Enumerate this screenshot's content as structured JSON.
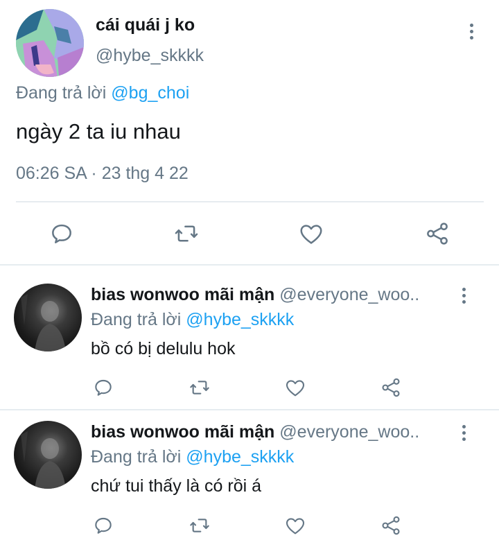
{
  "tweet": {
    "author_name": "cái quái j ko",
    "author_handle": "@hybe_skkkk",
    "replying_prefix": "Đang trả lời",
    "replying_to": "@bg_choi",
    "text": "ngày 2 ta iu nhau",
    "timestamp": "06:26 SA · 23 thg 4 22",
    "actions": [
      "reply-icon",
      "retweet-icon",
      "like-icon",
      "share-icon"
    ]
  },
  "replies": [
    {
      "author_name": "bias wonwoo mãi mận",
      "author_handle": "@everyone_woo..",
      "replying_prefix": "Đang trả lời",
      "replying_to": "@hybe_skkkk",
      "text": "bồ có bị delulu hok"
    },
    {
      "author_name": "bias wonwoo mãi mận",
      "author_handle": "@everyone_woo..",
      "replying_prefix": "Đang trả lời",
      "replying_to": "@hybe_skkkk",
      "text": "chứ tui thấy là có rồi á"
    }
  ],
  "colors": {
    "secondary_text": "#657786",
    "link": "#1da1f2",
    "icon": "#657786",
    "divider": "#e6ecf0"
  }
}
